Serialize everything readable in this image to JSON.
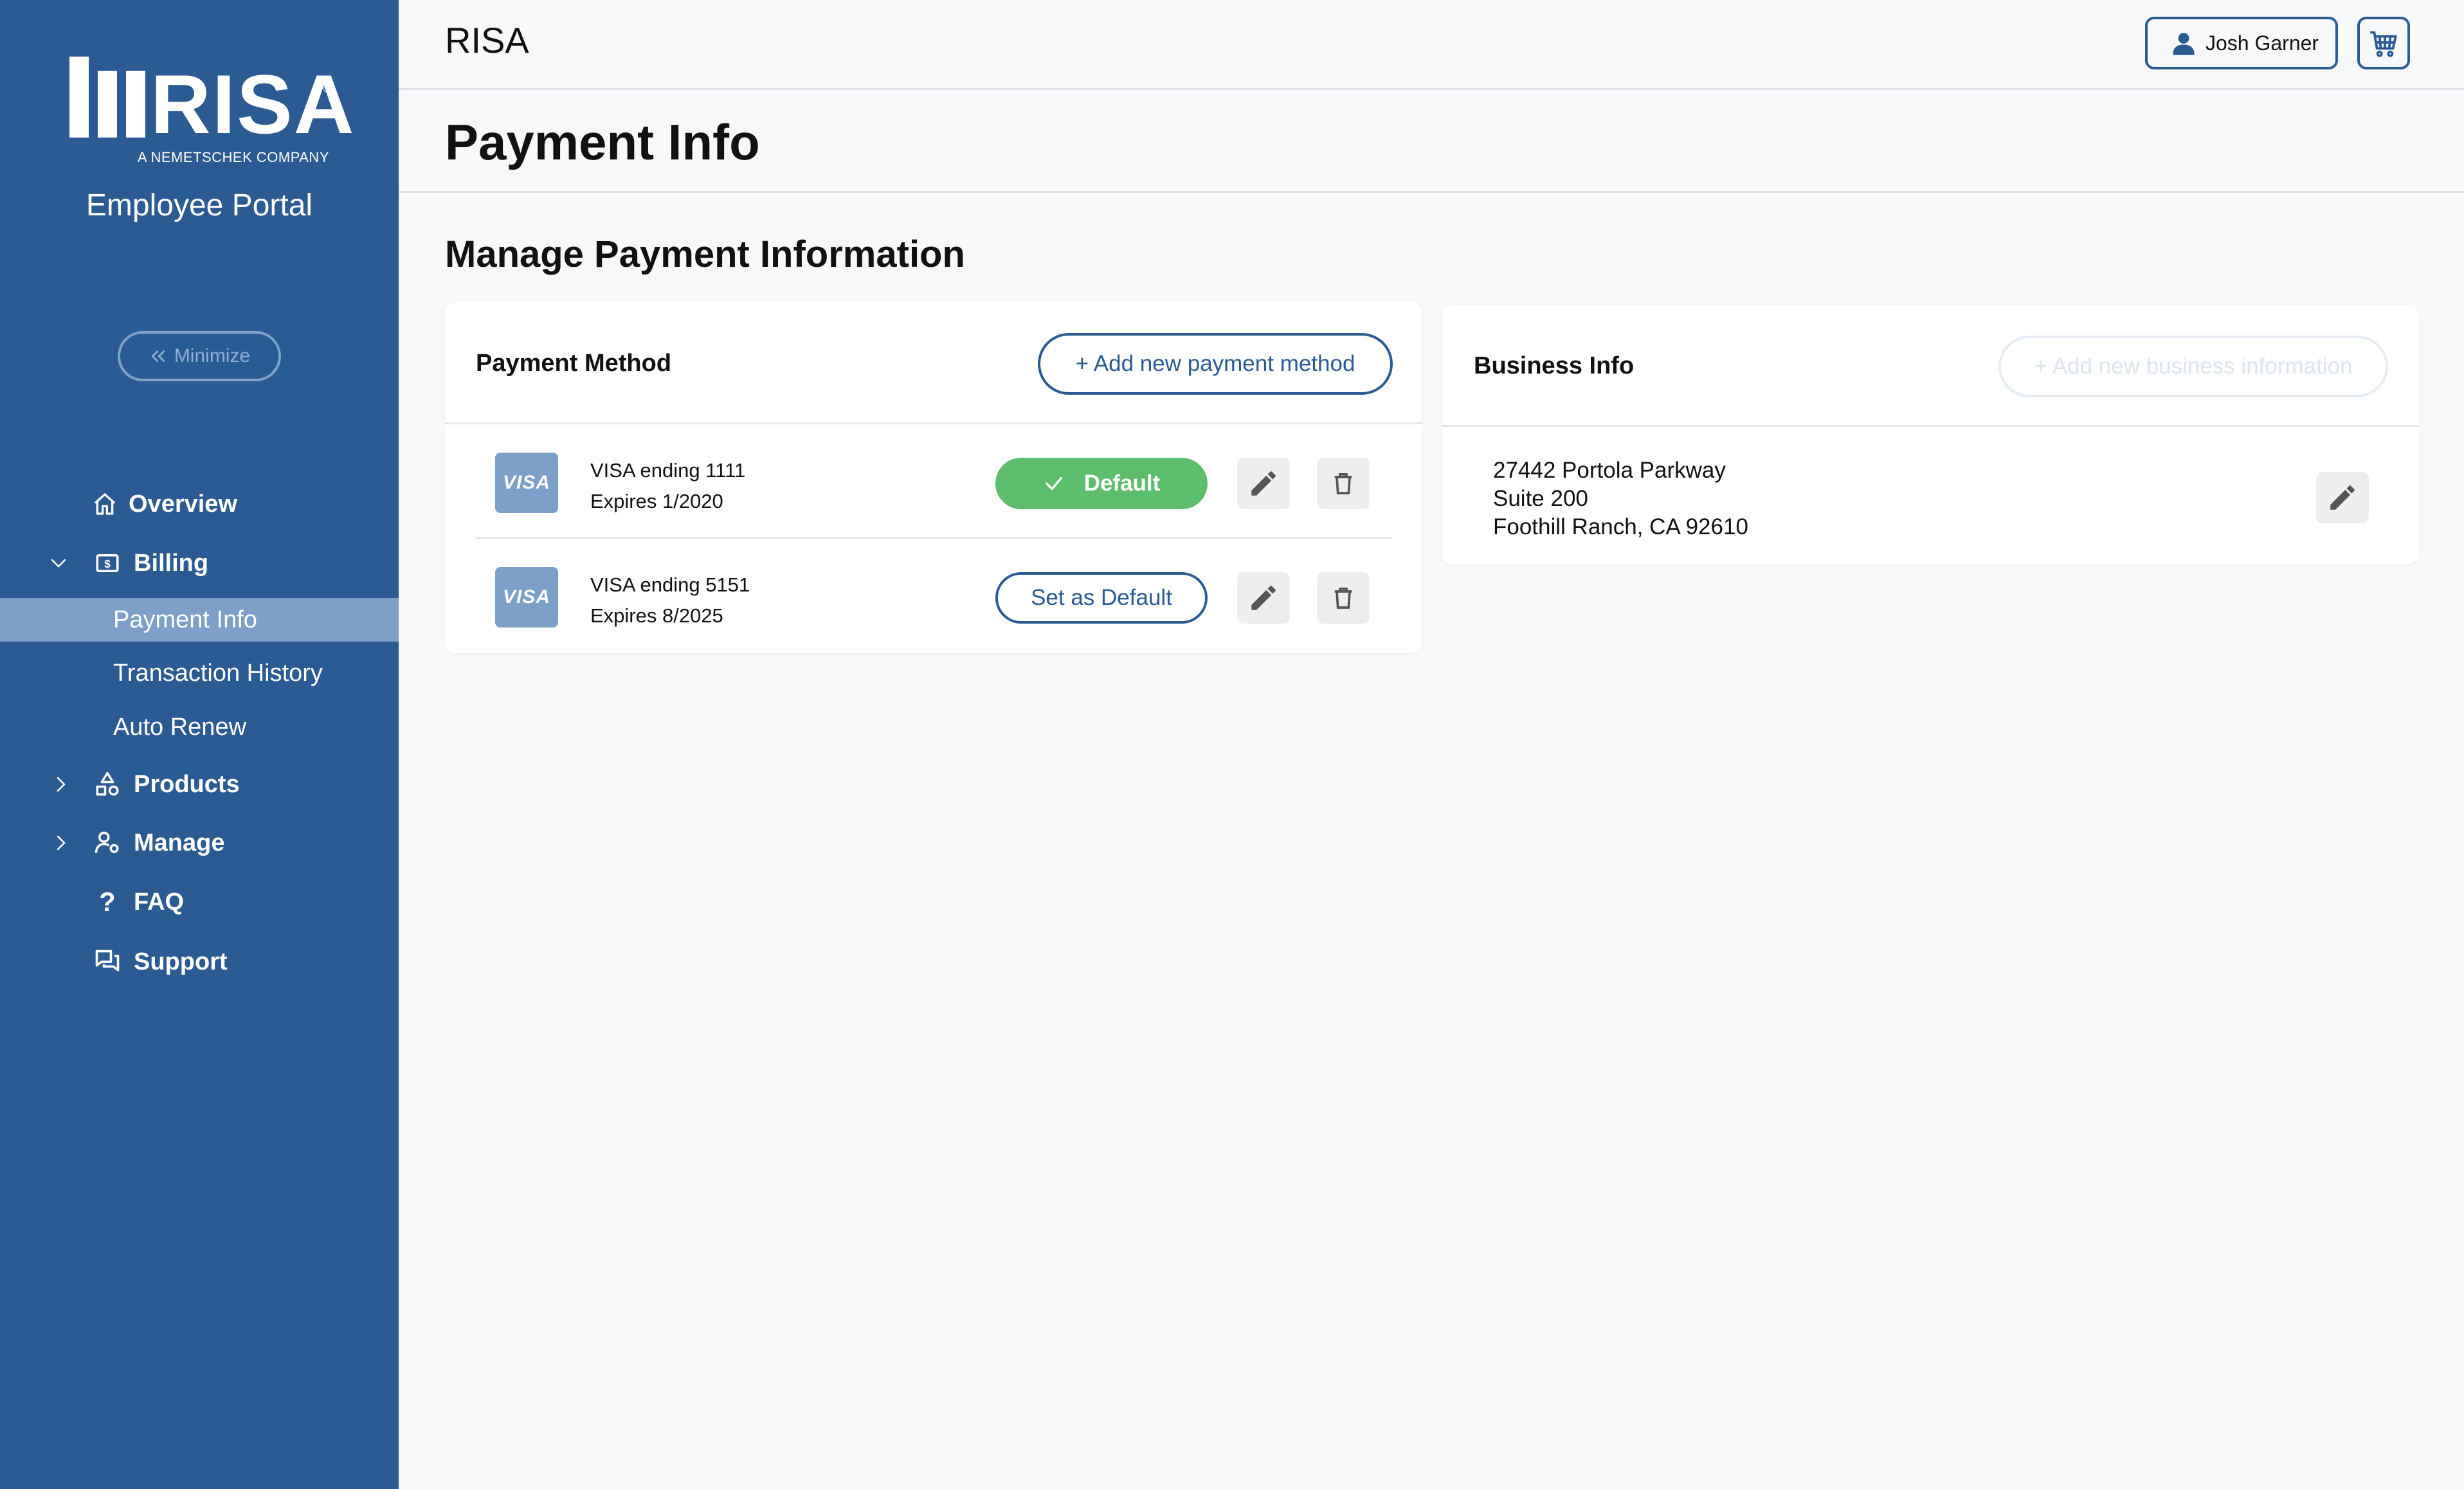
{
  "app": {
    "brand": "RISA",
    "logo": {
      "wordmark": "RISA",
      "tagline": "A NEMETSCHEK COMPANY"
    },
    "portal_title": "Employee Portal"
  },
  "sidebar": {
    "minimize_label": "Minimize",
    "items": [
      {
        "label": "Overview",
        "icon": "home-icon"
      },
      {
        "label": "Billing",
        "icon": "billing-icon",
        "expanded": true,
        "children": [
          {
            "label": "Payment Info",
            "active": true
          },
          {
            "label": "Transaction History"
          },
          {
            "label": "Auto Renew"
          }
        ]
      },
      {
        "label": "Products",
        "icon": "products-icon",
        "expanded": false
      },
      {
        "label": "Manage",
        "icon": "manage-icon",
        "expanded": false
      },
      {
        "label": "FAQ",
        "icon": "question-icon"
      },
      {
        "label": "Support",
        "icon": "chat-icon"
      }
    ]
  },
  "header": {
    "user_name": "Josh Garner",
    "cart_icon": "cart-icon"
  },
  "page": {
    "title": "Payment Info",
    "section_title": "Manage Payment Information"
  },
  "payment_card": {
    "title": "Payment Method",
    "add_label": "+ Add new payment method",
    "methods": [
      {
        "brand": "VISA",
        "name": "VISA ending 1111",
        "expires": "Expires 1/2020",
        "is_default": true,
        "default_label": "Default"
      },
      {
        "brand": "VISA",
        "name": "VISA ending 5151",
        "expires": "Expires 8/2025",
        "is_default": false,
        "set_default_label": "Set as Default"
      }
    ]
  },
  "business_card": {
    "title": "Business Info",
    "add_label": "+ Add new business information",
    "address": {
      "line1": "27442 Portola Parkway",
      "line2": "Suite 200",
      "line3": "Foothill Ranch, CA 92610"
    }
  },
  "colors": {
    "sidebar_bg": "#2a5b92",
    "sidebar_active": "#7b9fc9",
    "accent": "#2a5b92",
    "success": "#5cbd6a",
    "page_bg": "#f7f8fa"
  }
}
